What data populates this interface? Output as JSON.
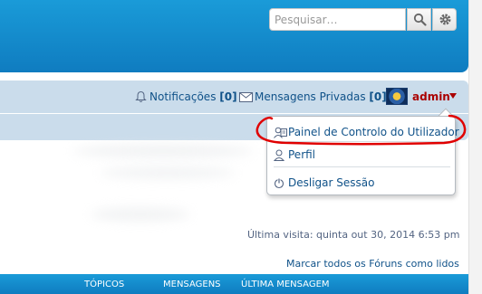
{
  "search": {
    "placeholder": "Pesquisar…"
  },
  "navbar": {
    "notifications_label": "Notificações",
    "notifications_count": "[0]",
    "messages_label": "Mensagens Privadas",
    "messages_count": "[0]",
    "username": "admin"
  },
  "dropdown": {
    "items": [
      {
        "label": "Painel de Controlo do Utilizador",
        "icon": "user-panel-icon"
      },
      {
        "label": "Perfil",
        "icon": "user-icon"
      },
      {
        "label": "Desligar Sessão",
        "icon": "power-icon"
      }
    ]
  },
  "main": {
    "last_visit": "Última visita: quinta out 30, 2014 6:53 pm",
    "mark_read": "Marcar todos os Fóruns como lidos"
  },
  "table_header": {
    "topics": "TÓPICOS",
    "posts": "MENSAGENS",
    "last_post": "ÚLTIMA MENSAGEM"
  },
  "colors": {
    "header_blue": "#1a9bd8",
    "link": "#105289",
    "username": "#aa0000",
    "annotation": "#e00000"
  }
}
